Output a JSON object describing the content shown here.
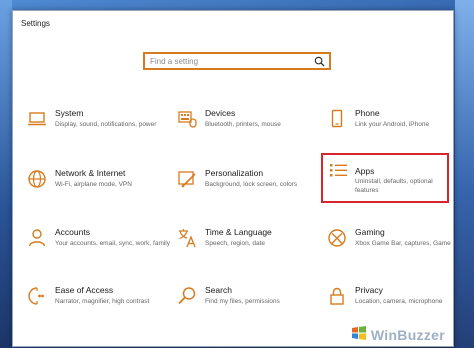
{
  "window": {
    "title": "Settings"
  },
  "search": {
    "placeholder": "Find a setting",
    "icon": "search-icon"
  },
  "accent": "#d87a1e",
  "highlight_color": "#d7262b",
  "categories": [
    {
      "name": "System",
      "desc": "Display, sound, notifications, power",
      "icon": "laptop-icon"
    },
    {
      "name": "Devices",
      "desc": "Bluetooth, printers, mouse",
      "icon": "keyboard-icon"
    },
    {
      "name": "Phone",
      "desc": "Link your Android, iPhone",
      "icon": "phone-icon"
    },
    {
      "name": "Network & Internet",
      "desc": "Wi-Fi, airplane mode, VPN",
      "icon": "globe-icon"
    },
    {
      "name": "Personalization",
      "desc": "Background, lock screen, colors",
      "icon": "paint-icon"
    },
    {
      "name": "Apps",
      "desc": "Uninstall, defaults, optional features",
      "icon": "apps-list-icon",
      "highlighted": true
    },
    {
      "name": "Accounts",
      "desc": "Your accounts, email, sync, work, family",
      "icon": "person-icon"
    },
    {
      "name": "Time & Language",
      "desc": "Speech, region, date",
      "icon": "time-language-icon"
    },
    {
      "name": "Gaming",
      "desc": "Xbox Game Bar, captures, Game Mode",
      "icon": "xbox-icon"
    },
    {
      "name": "Ease of Access",
      "desc": "Narrator, magnifier, high contrast",
      "icon": "ease-of-access-icon"
    },
    {
      "name": "Search",
      "desc": "Find my files, permissions",
      "icon": "search-icon"
    },
    {
      "name": "Privacy",
      "desc": "Location, camera, microphone",
      "icon": "lock-icon"
    }
  ],
  "watermark": {
    "text": "WinBuzzer"
  }
}
